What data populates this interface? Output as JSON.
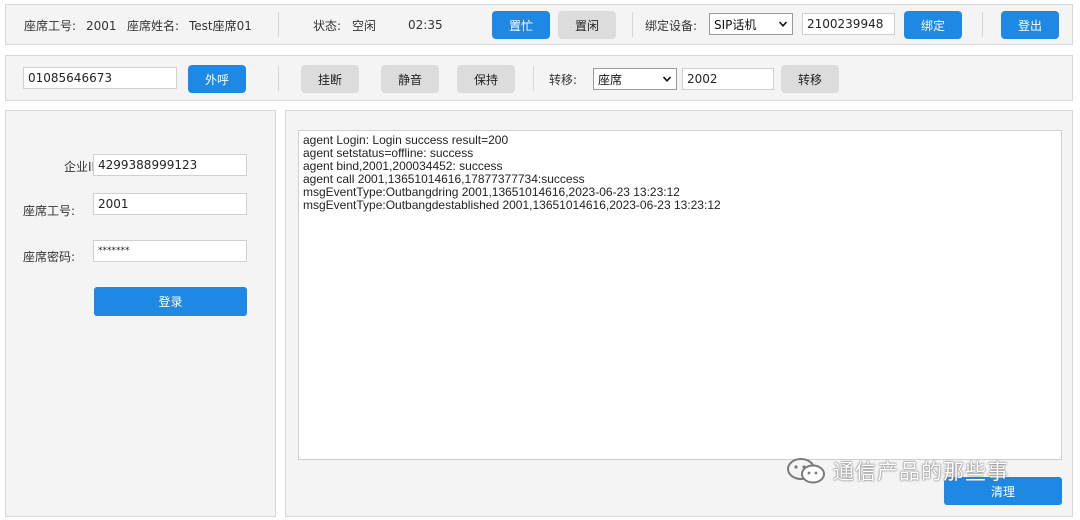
{
  "top_bar": {
    "agent_id_label": "座席工号:",
    "agent_id_value": "2001",
    "agent_name_label": "座席姓名:",
    "agent_name_value": "Test座席01",
    "status_label": "状态:",
    "status_value": "空闲",
    "timer": "02:35",
    "busy_button": "置忙",
    "idle_button": "置闲",
    "bind_device_label": "绑定设备:",
    "device_select": "SIP话机",
    "device_number": "2100239948",
    "bind_button": "绑定",
    "logout_button": "登出"
  },
  "call_bar": {
    "dial_number": "01085646673",
    "dial_button": "外呼",
    "hangup_button": "挂断",
    "mute_button": "静音",
    "hold_button": "保持",
    "transfer_label": "转移:",
    "transfer_type_select": "座席",
    "transfer_target": "2002",
    "transfer_button": "转移"
  },
  "login_form": {
    "company_id_label": "企业ID:",
    "company_id_value": "4299388999123",
    "agent_id_label": "座席工号:",
    "agent_id_value": "2001",
    "password_label": "座席密码:",
    "password_value": "*******",
    "login_button": "登录"
  },
  "log_panel": {
    "lines": [
      "agent Login: Login success result=200",
      "agent setstatus=offline: success",
      "agent bind,2001,200034452: success",
      "agent call 2001,13651014616,17877377734:success",
      "msgEventType:Outbangdring 2001,13651014616,2023-06-23 13:23:12",
      "msgEventType:Outbangdestablished 2001,13651014616,2023-06-23 13:23:12"
    ],
    "clear_button": "清理"
  },
  "watermark": {
    "text": "通信产品的那些事",
    "icon": "wechat-icon"
  },
  "colors": {
    "primary_button": "#1e88e5",
    "secondary_button": "#dcdcdc",
    "panel_background": "#f4f4f4"
  }
}
